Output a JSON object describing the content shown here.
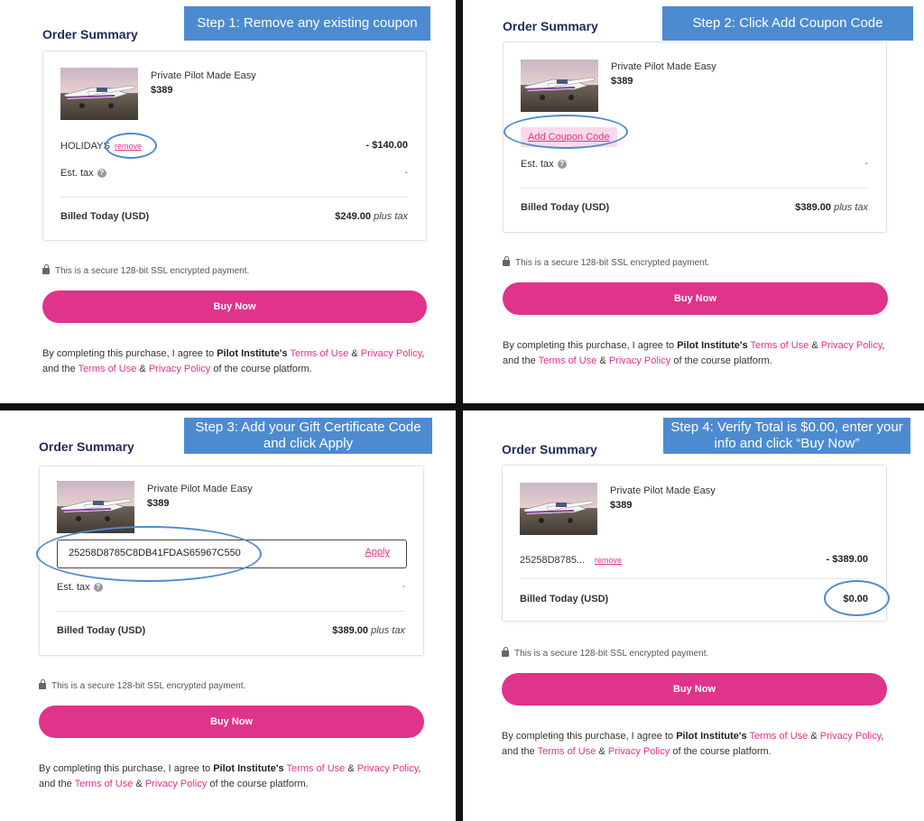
{
  "colors": {
    "accent": "#e0338a",
    "banner": "#4d8bd1",
    "title": "#1f2a5a"
  },
  "icons": {
    "help": "question-circle-icon",
    "lock": "lock-icon"
  },
  "common": {
    "order_summary": "Order Summary",
    "product_name": "Private Pilot Made Easy",
    "product_price": "$389",
    "est_tax": "Est. tax",
    "help_glyph": "?",
    "tax_value": "-",
    "billed_label": "Billed Today (USD)",
    "plus_tax": "plus tax",
    "secure_text": "This is a secure 128-bit SSL encrypted payment.",
    "buy_now": "Buy Now",
    "terms": {
      "part1": "By completing this purchase, I agree to ",
      "company": "Pilot Institute's",
      "link_terms": "Terms of Use",
      "amp": " & ",
      "link_privacy": "Privacy Policy",
      "part2": ", and the ",
      "part3": " of the course platform."
    }
  },
  "steps": [
    {
      "banner": "Step 1: Remove any existing coupon",
      "coupon_label": "HOLIDAYS",
      "remove": "remove",
      "discount": "- $140.00",
      "billed_value": "$249.00"
    },
    {
      "banner": "Step 2: Click Add Coupon Code",
      "add_coupon": "Add Coupon Code",
      "billed_value": "$389.00"
    },
    {
      "banner": "Step 3: Add your Gift Certificate Code and click Apply",
      "coupon_input": "25258D8785C8DB41FDAS65967C550",
      "apply": "Apply",
      "billed_value": "$389.00"
    },
    {
      "banner": "Step 4: Verify Total is $0.00, enter your info and click “Buy Now”",
      "coupon_label": "25258D8785...",
      "remove": "remove",
      "discount": "- $389.00",
      "billed_value": "$0.00"
    }
  ]
}
